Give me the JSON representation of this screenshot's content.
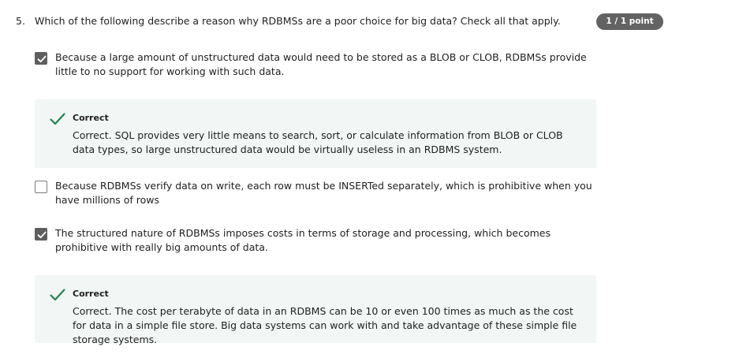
{
  "question": {
    "number": "5.",
    "text": "Which of the following describe a reason why RDBMSs are a poor choice for big data? Check all that apply.",
    "score": "1 / 1 point"
  },
  "options": [
    {
      "checked": true,
      "label": "Because a large amount of unstructured data would need to be stored as a BLOB or CLOB, RDBMSs provide little to no support for working with such data.",
      "feedback": {
        "title": "Correct",
        "text": "Correct. SQL provides very little means to search, sort, or calculate information from BLOB or CLOB data types, so large unstructured data would be virtually useless in an RDBMS system."
      }
    },
    {
      "checked": false,
      "label": "Because RDBMSs verify data on write, each row must be INSERTed separately, which is prohibitive when you have millions of rows"
    },
    {
      "checked": true,
      "label": "The structured nature of RDBMSs imposes costs in terms of storage and processing, which becomes prohibitive with really big amounts of data.",
      "feedback": {
        "title": "Correct",
        "text": "Correct. The cost per terabyte of data in an RDBMS can be 10 or even 100 times as much as the cost for data in a simple file store. Big data systems can work with and take advantage of these simple file storage systems."
      }
    }
  ],
  "colors": {
    "correct_green": "#1f8354",
    "feedback_bg": "#f2f7f5",
    "badge_bg": "#636363",
    "checkbox_checked": "#5e5e5e"
  },
  "icons": {
    "checked_box": "checkbox-checked-icon",
    "unchecked_box": "checkbox-unchecked-icon",
    "correct": "checkmark-icon"
  }
}
